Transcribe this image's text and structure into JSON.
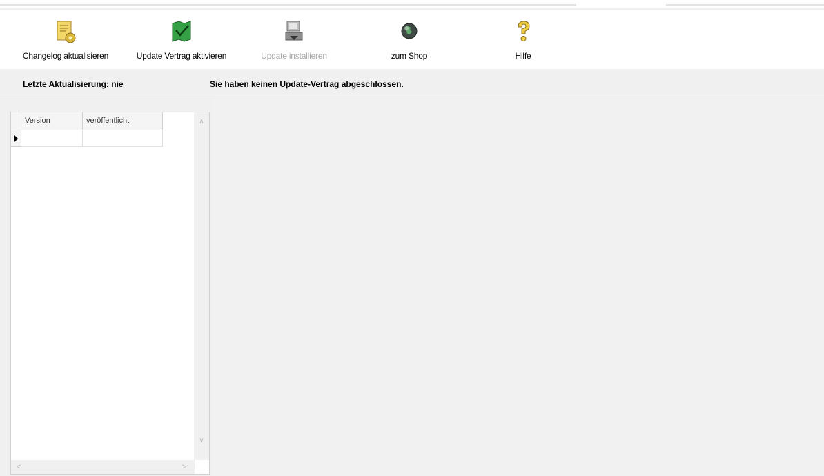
{
  "toolbar": {
    "buttons": [
      {
        "id": "changelog",
        "label": "Changelog aktualisieren",
        "icon": "changelog-document-gear-icon",
        "enabled": true
      },
      {
        "id": "activate",
        "label": "Update Vertrag aktivieren",
        "icon": "contract-map-check-icon",
        "enabled": true
      },
      {
        "id": "install",
        "label": "Update installieren",
        "icon": "install-update-computer-icon",
        "enabled": false
      },
      {
        "id": "shop",
        "label": "zum Shop",
        "icon": "globe-icon",
        "enabled": true
      },
      {
        "id": "help",
        "label": "Hilfe",
        "icon": "help-question-icon",
        "enabled": true
      }
    ]
  },
  "info": {
    "last_update": "Letzte Aktualisierung: nie",
    "contract_status": "Sie haben keinen Update-Vertrag abgeschlossen."
  },
  "grid": {
    "columns": [
      "Version",
      "veröffentlicht"
    ],
    "rows": [
      [
        "",
        ""
      ]
    ]
  },
  "colors": {
    "toolbar_bg": "#ffffff",
    "panel_bg": "#f0f0f0",
    "disabled_text": "#a8a8a8",
    "icon_gold": "#e6c23a",
    "icon_green": "#2f8f3a"
  }
}
